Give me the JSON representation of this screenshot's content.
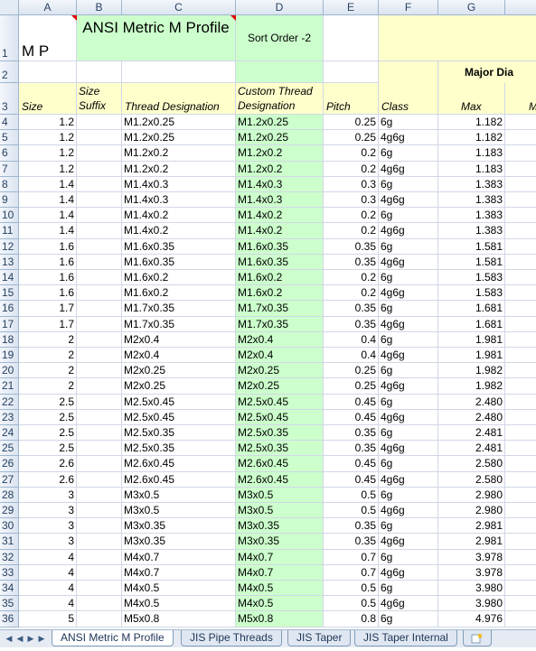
{
  "columns": [
    "A",
    "B",
    "C",
    "D",
    "E",
    "F",
    "G",
    ""
  ],
  "row1": {
    "a": "M P",
    "bc": "ANSI Metric M Profile",
    "d": "Sort Order -2"
  },
  "row2": {
    "major_dia": "Major Dia"
  },
  "row3": {
    "size": "Size",
    "size_suffix": "Size Suffix",
    "thread_designation": "Thread Designation",
    "custom": "Custom Thread Designation",
    "pitch": "Pitch",
    "class": "Class",
    "max": "Max",
    "next": "M"
  },
  "rows": [
    {
      "n": "4",
      "size": "1.2",
      "td": "M1.2x0.25",
      "ctd": "M1.2x0.25",
      "pitch": "0.25",
      "cls": "6g",
      "max": "1.182"
    },
    {
      "n": "5",
      "size": "1.2",
      "td": "M1.2x0.25",
      "ctd": "M1.2x0.25",
      "pitch": "0.25",
      "cls": "4g6g",
      "max": "1.182"
    },
    {
      "n": "6",
      "size": "1.2",
      "td": "M1.2x0.2",
      "ctd": "M1.2x0.2",
      "pitch": "0.2",
      "cls": "6g",
      "max": "1.183"
    },
    {
      "n": "7",
      "size": "1.2",
      "td": "M1.2x0.2",
      "ctd": "M1.2x0.2",
      "pitch": "0.2",
      "cls": "4g6g",
      "max": "1.183"
    },
    {
      "n": "8",
      "size": "1.4",
      "td": "M1.4x0.3",
      "ctd": "M1.4x0.3",
      "pitch": "0.3",
      "cls": "6g",
      "max": "1.383"
    },
    {
      "n": "9",
      "size": "1.4",
      "td": "M1.4x0.3",
      "ctd": "M1.4x0.3",
      "pitch": "0.3",
      "cls": "4g6g",
      "max": "1.383"
    },
    {
      "n": "10",
      "size": "1.4",
      "td": "M1.4x0.2",
      "ctd": "M1.4x0.2",
      "pitch": "0.2",
      "cls": "6g",
      "max": "1.383"
    },
    {
      "n": "11",
      "size": "1.4",
      "td": "M1.4x0.2",
      "ctd": "M1.4x0.2",
      "pitch": "0.2",
      "cls": "4g6g",
      "max": "1.383"
    },
    {
      "n": "12",
      "size": "1.6",
      "td": "M1.6x0.35",
      "ctd": "M1.6x0.35",
      "pitch": "0.35",
      "cls": "6g",
      "max": "1.581"
    },
    {
      "n": "13",
      "size": "1.6",
      "td": "M1.6x0.35",
      "ctd": "M1.6x0.35",
      "pitch": "0.35",
      "cls": "4g6g",
      "max": "1.581"
    },
    {
      "n": "14",
      "size": "1.6",
      "td": "M1.6x0.2",
      "ctd": "M1.6x0.2",
      "pitch": "0.2",
      "cls": "6g",
      "max": "1.583"
    },
    {
      "n": "15",
      "size": "1.6",
      "td": "M1.6x0.2",
      "ctd": "M1.6x0.2",
      "pitch": "0.2",
      "cls": "4g6g",
      "max": "1.583"
    },
    {
      "n": "16",
      "size": "1.7",
      "td": "M1.7x0.35",
      "ctd": "M1.7x0.35",
      "pitch": "0.35",
      "cls": "6g",
      "max": "1.681"
    },
    {
      "n": "17",
      "size": "1.7",
      "td": "M1.7x0.35",
      "ctd": "M1.7x0.35",
      "pitch": "0.35",
      "cls": "4g6g",
      "max": "1.681"
    },
    {
      "n": "18",
      "size": "2",
      "td": "M2x0.4",
      "ctd": "M2x0.4",
      "pitch": "0.4",
      "cls": "6g",
      "max": "1.981"
    },
    {
      "n": "19",
      "size": "2",
      "td": "M2x0.4",
      "ctd": "M2x0.4",
      "pitch": "0.4",
      "cls": "4g6g",
      "max": "1.981"
    },
    {
      "n": "20",
      "size": "2",
      "td": "M2x0.25",
      "ctd": "M2x0.25",
      "pitch": "0.25",
      "cls": "6g",
      "max": "1.982"
    },
    {
      "n": "21",
      "size": "2",
      "td": "M2x0.25",
      "ctd": "M2x0.25",
      "pitch": "0.25",
      "cls": "4g6g",
      "max": "1.982"
    },
    {
      "n": "22",
      "size": "2.5",
      "td": "M2.5x0.45",
      "ctd": "M2.5x0.45",
      "pitch": "0.45",
      "cls": "6g",
      "max": "2.480"
    },
    {
      "n": "23",
      "size": "2.5",
      "td": "M2.5x0.45",
      "ctd": "M2.5x0.45",
      "pitch": "0.45",
      "cls": "4g6g",
      "max": "2.480"
    },
    {
      "n": "24",
      "size": "2.5",
      "td": "M2.5x0.35",
      "ctd": "M2.5x0.35",
      "pitch": "0.35",
      "cls": "6g",
      "max": "2.481"
    },
    {
      "n": "25",
      "size": "2.5",
      "td": "M2.5x0.35",
      "ctd": "M2.5x0.35",
      "pitch": "0.35",
      "cls": "4g6g",
      "max": "2.481"
    },
    {
      "n": "26",
      "size": "2.6",
      "td": "M2.6x0.45",
      "ctd": "M2.6x0.45",
      "pitch": "0.45",
      "cls": "6g",
      "max": "2.580"
    },
    {
      "n": "27",
      "size": "2.6",
      "td": "M2.6x0.45",
      "ctd": "M2.6x0.45",
      "pitch": "0.45",
      "cls": "4g6g",
      "max": "2.580"
    },
    {
      "n": "28",
      "size": "3",
      "td": "M3x0.5",
      "ctd": "M3x0.5",
      "pitch": "0.5",
      "cls": "6g",
      "max": "2.980"
    },
    {
      "n": "29",
      "size": "3",
      "td": "M3x0.5",
      "ctd": "M3x0.5",
      "pitch": "0.5",
      "cls": "4g6g",
      "max": "2.980"
    },
    {
      "n": "30",
      "size": "3",
      "td": "M3x0.35",
      "ctd": "M3x0.35",
      "pitch": "0.35",
      "cls": "6g",
      "max": "2.981"
    },
    {
      "n": "31",
      "size": "3",
      "td": "M3x0.35",
      "ctd": "M3x0.35",
      "pitch": "0.35",
      "cls": "4g6g",
      "max": "2.981"
    },
    {
      "n": "32",
      "size": "4",
      "td": "M4x0.7",
      "ctd": "M4x0.7",
      "pitch": "0.7",
      "cls": "6g",
      "max": "3.978"
    },
    {
      "n": "33",
      "size": "4",
      "td": "M4x0.7",
      "ctd": "M4x0.7",
      "pitch": "0.7",
      "cls": "4g6g",
      "max": "3.978"
    },
    {
      "n": "34",
      "size": "4",
      "td": "M4x0.5",
      "ctd": "M4x0.5",
      "pitch": "0.5",
      "cls": "6g",
      "max": "3.980"
    },
    {
      "n": "35",
      "size": "4",
      "td": "M4x0.5",
      "ctd": "M4x0.5",
      "pitch": "0.5",
      "cls": "4g6g",
      "max": "3.980"
    },
    {
      "n": "36",
      "size": "5",
      "td": "M5x0.8",
      "ctd": "M5x0.8",
      "pitch": "0.8",
      "cls": "6g",
      "max": "4.976"
    }
  ],
  "row_numbers_top": [
    "1",
    "2",
    "3"
  ],
  "tabs": [
    "ANSI Metric M Profile",
    "JIS Pipe Threads",
    "JIS Taper",
    "JIS Taper Internal"
  ],
  "nav": [
    "first-sheet-icon",
    "prev-sheet-icon",
    "next-sheet-icon",
    "last-sheet-icon",
    "insert-sheet-icon"
  ]
}
